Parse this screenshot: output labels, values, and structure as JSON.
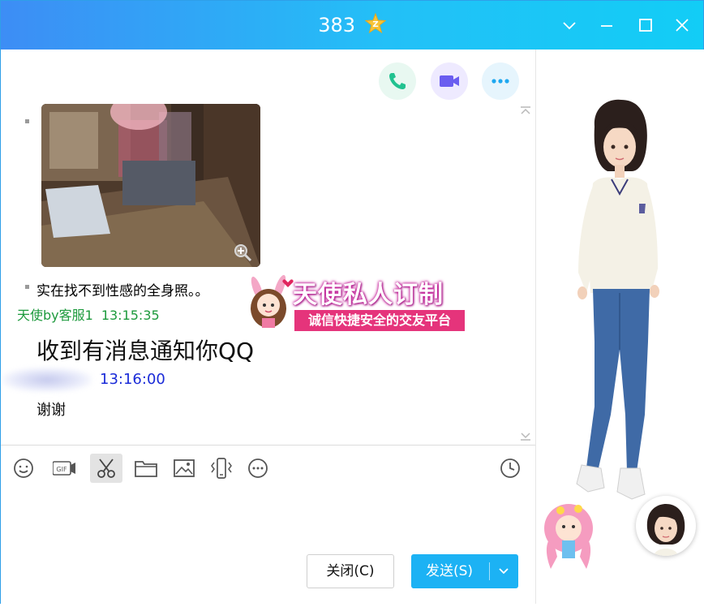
{
  "window": {
    "title": "383",
    "badge_icon": "star-z-badge",
    "controls": [
      "chevron-down-icon",
      "minimize-icon",
      "maximize-icon",
      "close-icon"
    ]
  },
  "header_actions": [
    {
      "name": "voice-call",
      "icon": "phone-icon",
      "color": "#21c290",
      "bg": "#e8f8f1"
    },
    {
      "name": "video-call",
      "icon": "video-icon",
      "color": "#6a5df0",
      "bg": "#eeeaff"
    },
    {
      "name": "more",
      "icon": "more-icon",
      "color": "#1ea8f0",
      "bg": "#e6f5fd"
    }
  ],
  "messages": {
    "caption_text": "实在找不到性感的全身照。。",
    "sender_name": "天使by客服1",
    "sender_time": "13:15:35",
    "big_text": "收到有消息通知你QQ",
    "my_time": "13:16:00",
    "reply_text": "谢谢"
  },
  "ad_banner": {
    "line1": "天使私人订制",
    "line2": "诚信快捷安全的交友平台"
  },
  "toolbar": {
    "tools": [
      "emoji-icon",
      "gif-icon",
      "screenshot-icon",
      "folder-icon",
      "image-icon",
      "shake-icon",
      "more-tools-icon"
    ],
    "history_icon": "clock-icon"
  },
  "buttons": {
    "close_label": "关闭(C)",
    "send_label": "发送(S)"
  },
  "colors": {
    "accent": "#1cb2f4",
    "sender_green": "#1d9a3d",
    "self_time_blue": "#1a2bd8"
  }
}
